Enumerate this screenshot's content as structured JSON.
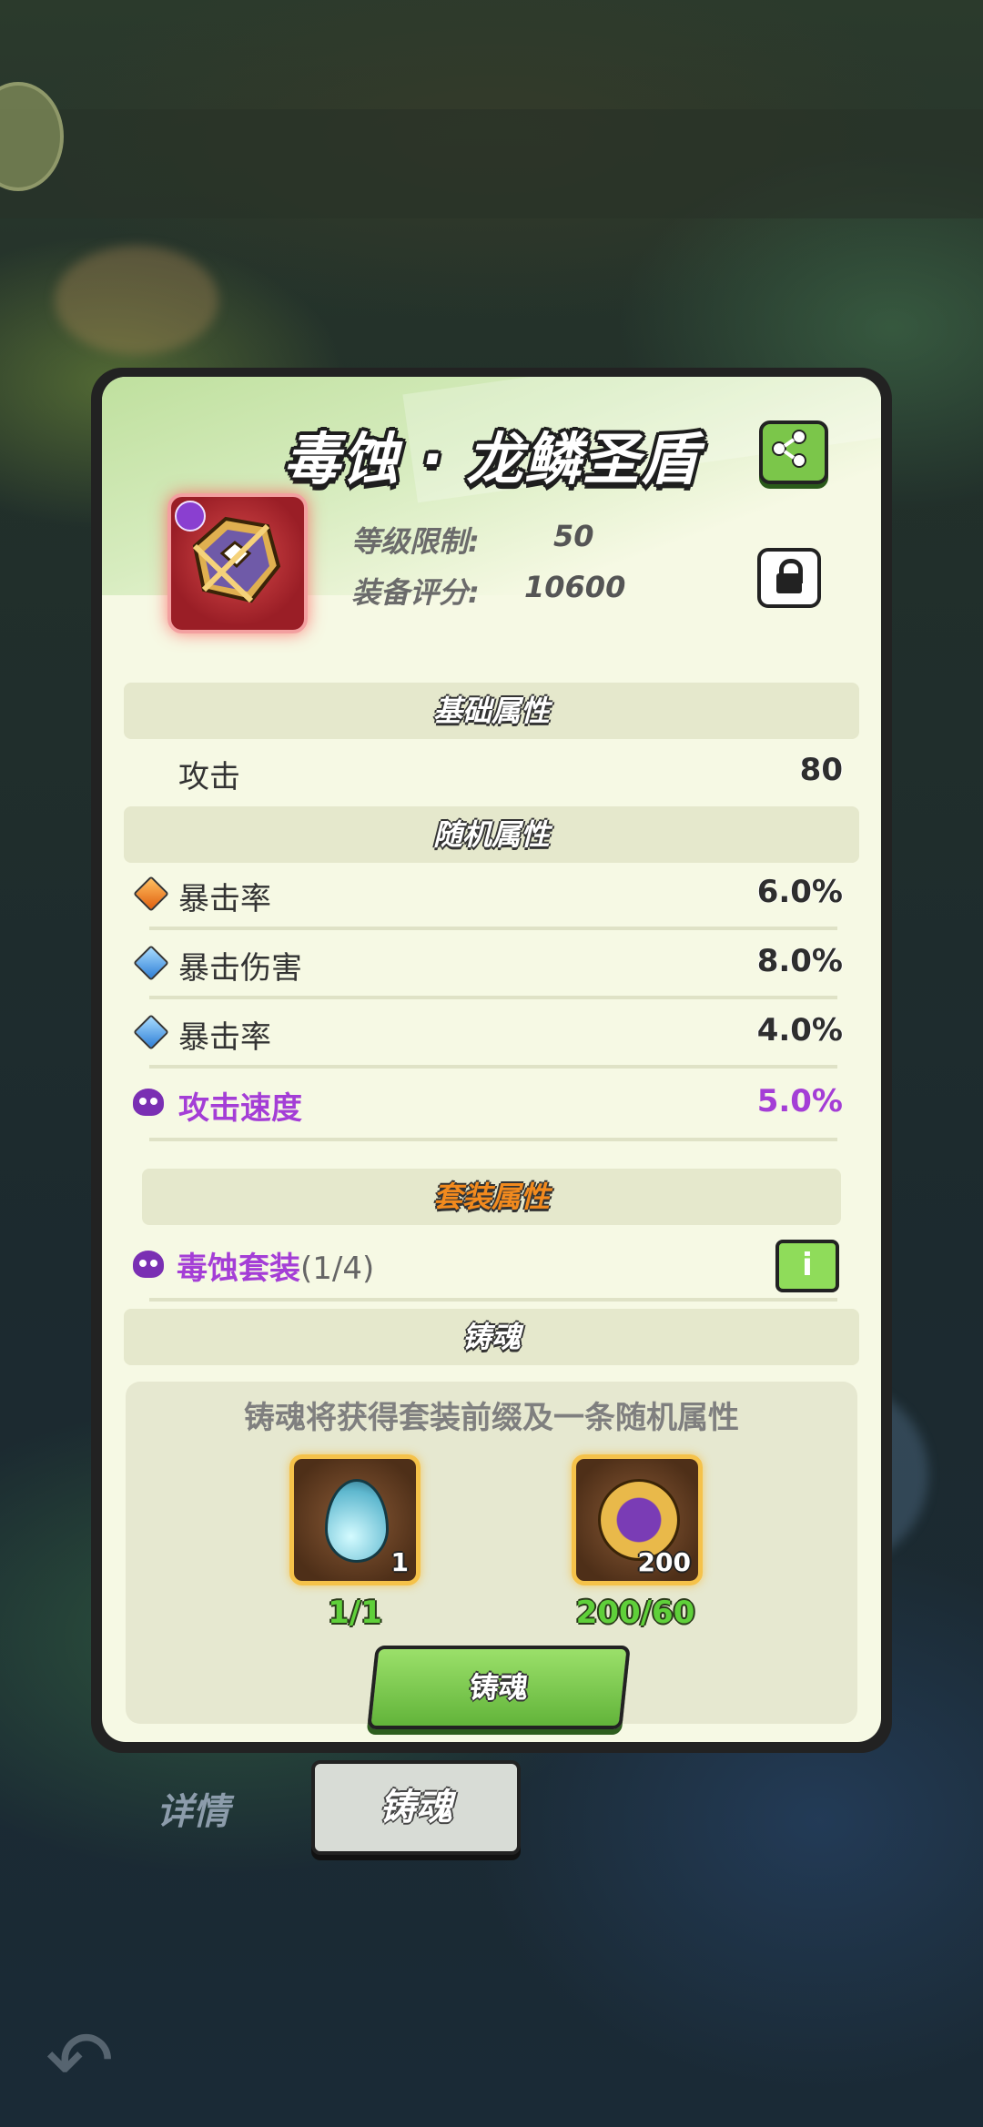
{
  "item": {
    "name": "毒蚀 · 龙鳞圣盾",
    "level_label": "等级限制:",
    "level_value": "50",
    "score_label": "装备评分:",
    "score_value": "10600"
  },
  "icons": {
    "share": "share-icon",
    "lock": "lock-icon",
    "info": "info-icon",
    "back": "back-arrow-icon",
    "skull": "poison-skull-icon"
  },
  "base_section": {
    "title": "基础属性",
    "rows": [
      {
        "label": "攻击",
        "value": "80"
      }
    ]
  },
  "random_section": {
    "title": "随机属性",
    "rows": [
      {
        "gem": "orange-gem-icon",
        "label": "暴击率",
        "value": "6.0%"
      },
      {
        "gem": "blue-gem-icon",
        "label": "暴击伤害",
        "value": "8.0%"
      },
      {
        "gem": "blue-gem-icon",
        "label": "暴击率",
        "value": "4.0%"
      },
      {
        "gem": "poison-skull-icon",
        "label": "攻击速度",
        "value": "5.0%"
      }
    ]
  },
  "set_section": {
    "title": "套装属性",
    "set_name": "毒蚀套装",
    "set_count": "(1/4)"
  },
  "forge_section": {
    "title": "铸魂",
    "hint": "铸魂将获得套装前缀及一条随机属性",
    "materials": [
      {
        "icon": "water-drop-icon",
        "count": "1",
        "progress": "1/1"
      },
      {
        "icon": "gold-coin-icon",
        "count": "200",
        "progress": "200/60"
      }
    ],
    "button_label": "铸魂"
  },
  "tabs": {
    "details": "详情",
    "forge": "铸魂"
  },
  "colors": {
    "panel_bg": "#f6f9e4",
    "accent_green": "#7bc64a",
    "poison_purple": "#a43ed6",
    "progress_green": "#5fd03a"
  }
}
